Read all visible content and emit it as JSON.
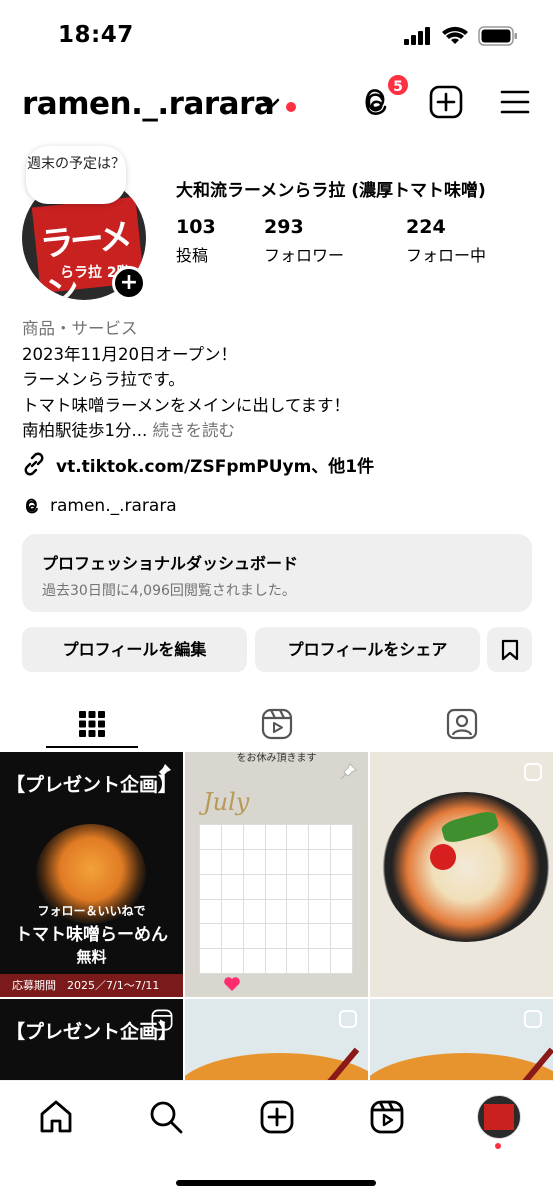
{
  "status_bar": {
    "time": "18:47"
  },
  "header": {
    "username": "ramen._.rarara",
    "threads_badge": "5"
  },
  "profile": {
    "note": "週末の予定は？",
    "display_name": "大和流ラーメンらラ拉 (濃厚トマト味噌)",
    "stats": [
      {
        "value": "103",
        "label": "投稿"
      },
      {
        "value": "293",
        "label": "フォロワー"
      },
      {
        "value": "224",
        "label": "フォロー中"
      }
    ],
    "category": "商品・サービス",
    "bio_lines": [
      "2023年11月20日オープン！",
      "ラーメンらラ拉です。",
      "トマト味噌ラーメンをメインに出してます！",
      "南柏駅徒歩1分..."
    ],
    "more_label": "続きを読む",
    "link": "vt.tiktok.com/ZSFpmPUym、他1件",
    "threads_handle": "ramen._.rarara"
  },
  "dashboard": {
    "title": "プロフェッショナルダッシュボード",
    "subtitle": "過去30日間に4,096回閲覧されました。"
  },
  "buttons": {
    "edit": "プロフィールを編集",
    "share": "プロフィールをシェア"
  },
  "posts": {
    "p1": {
      "header": "【プレゼント企画】",
      "line1": "フォロー＆いいねで",
      "line2": "トマト味噌らーめん",
      "line3": "無料",
      "bar": "応募期間　2025／7/1〜7/11"
    },
    "p2": {
      "top": "をお休み頂きます",
      "month": "July"
    },
    "p4": {
      "header": "【プレゼント企画】"
    }
  }
}
